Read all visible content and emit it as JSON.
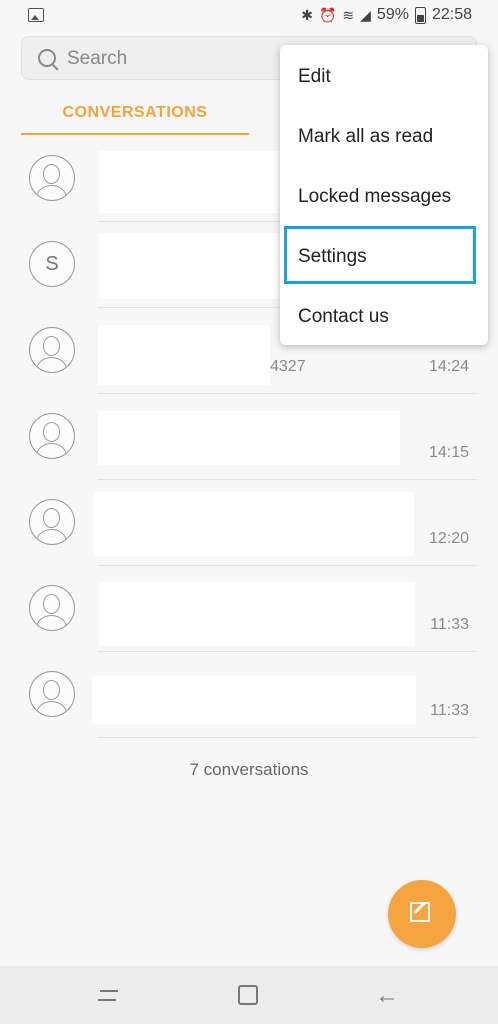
{
  "status_bar": {
    "battery": "59%",
    "time": "22:58"
  },
  "search": {
    "placeholder": "Search"
  },
  "tabs": {
    "conversations": "CONVERSATIONS"
  },
  "conversations": [
    {
      "avatar_letter": "",
      "time": ""
    },
    {
      "avatar_letter": "S",
      "time": ""
    },
    {
      "avatar_letter": "",
      "time": "14:24",
      "partial_text": "4327"
    },
    {
      "avatar_letter": "",
      "time": "14:15"
    },
    {
      "avatar_letter": "",
      "time": "12:20"
    },
    {
      "avatar_letter": "",
      "time": "11:33"
    },
    {
      "avatar_letter": "",
      "time": "11:33"
    }
  ],
  "count_label": "7 conversations",
  "menu": {
    "items": [
      "Edit",
      "Mark all as read",
      "Locked messages",
      "Settings",
      "Contact us"
    ],
    "highlighted": "Settings",
    "highlight_color": "#1aa2d8"
  },
  "colors": {
    "accent": "#f2a33a",
    "fab": "#f5a540"
  },
  "icons": {
    "fab": "compose-icon",
    "nav": [
      "recent-apps-icon",
      "home-icon",
      "back-icon"
    ]
  }
}
